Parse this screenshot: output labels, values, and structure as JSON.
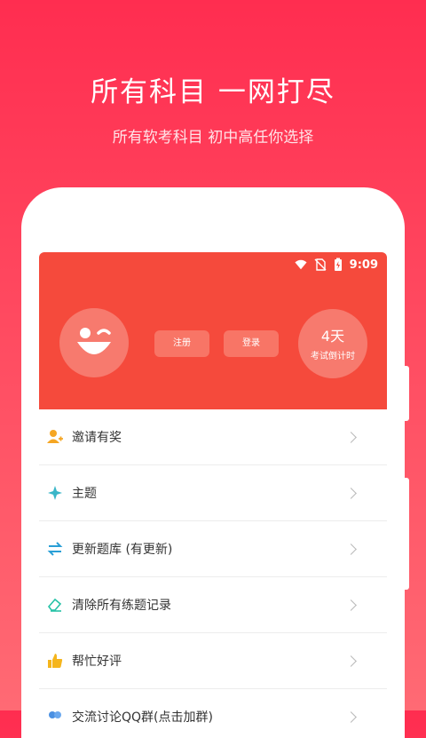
{
  "promo": {
    "title": "所有科目 一网打尽",
    "subtitle": "所有软考科目 初中高任你选择"
  },
  "status_bar": {
    "time": "9:09"
  },
  "header": {
    "register_label": "注册",
    "login_label": "登录",
    "countdown_value": "4天",
    "countdown_label": "考试倒计时"
  },
  "menu": [
    {
      "label": "邀请有奖",
      "icon": "invite-user-icon"
    },
    {
      "label": "主题",
      "icon": "theme-icon"
    },
    {
      "label": "更新题库 (有更新)",
      "icon": "update-arrows-icon"
    },
    {
      "label": "清除所有练题记录",
      "icon": "eraser-icon"
    },
    {
      "label": "帮忙好评",
      "icon": "thumbs-up-icon"
    },
    {
      "label": "交流讨论QQ群(点击加群)",
      "icon": "group-chat-icon"
    }
  ],
  "colors": {
    "background_top": "#ff2d50",
    "hero": "#f54a3c",
    "hero_circle": "#f77a6e"
  }
}
